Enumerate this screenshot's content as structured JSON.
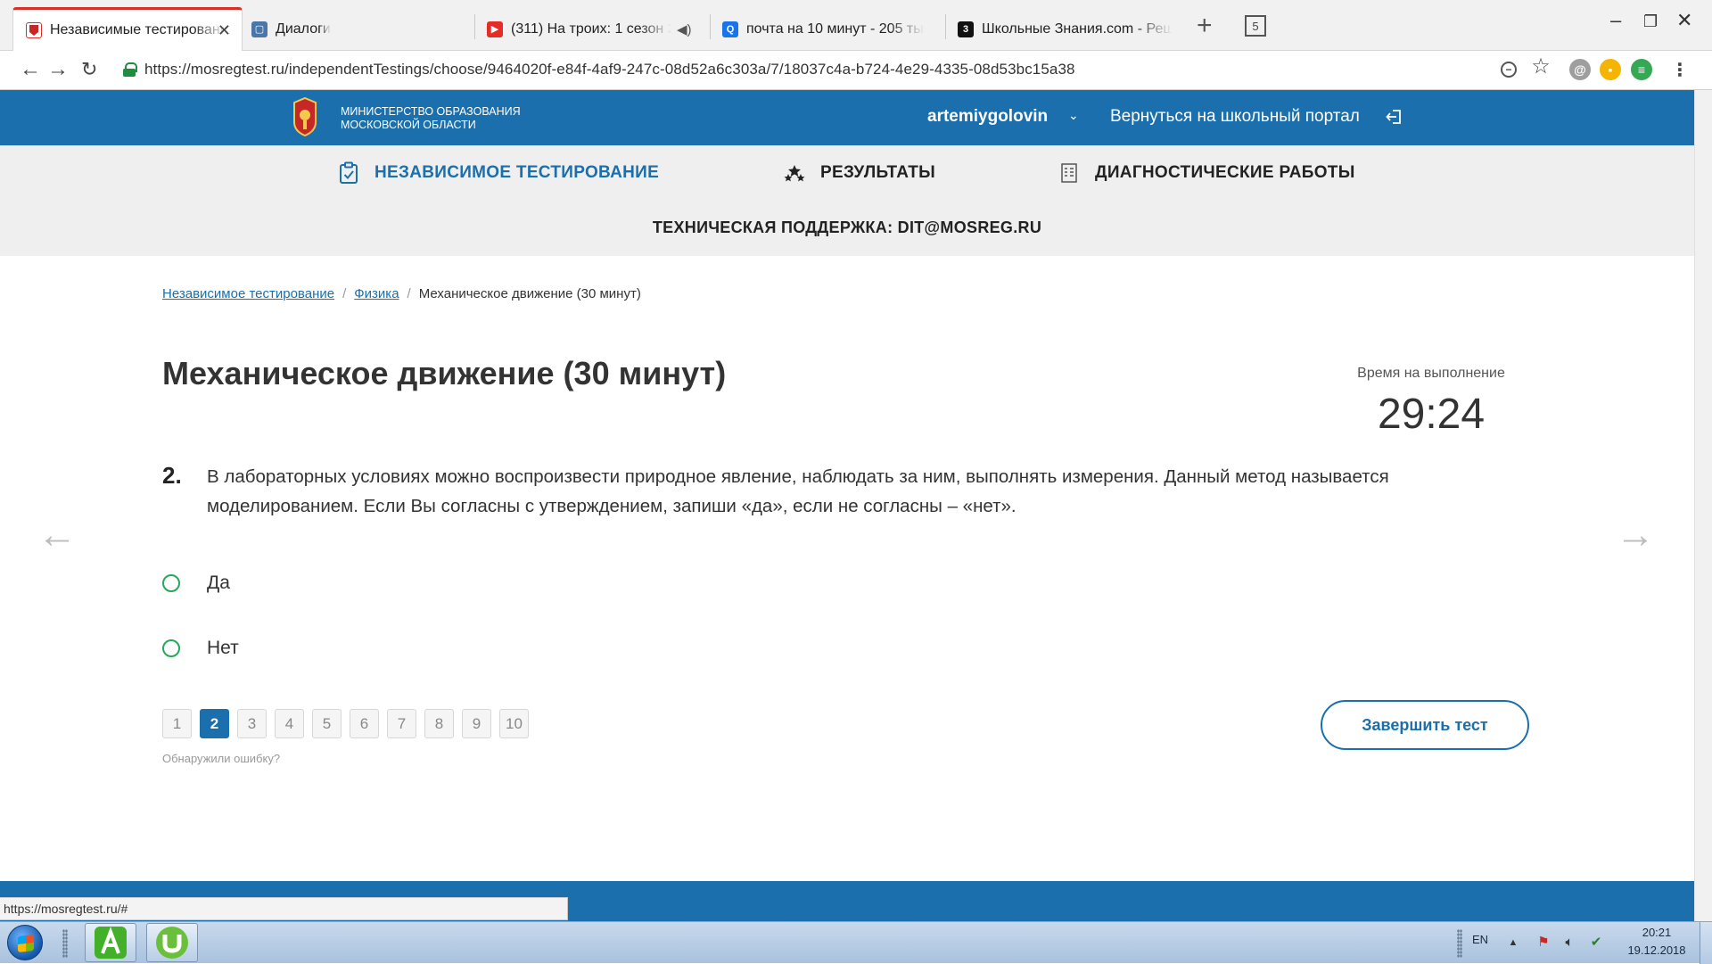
{
  "browser": {
    "tabs": [
      {
        "title": "Независимые тестирования",
        "active": true
      },
      {
        "title": "Диалоги",
        "active": false
      },
      {
        "title": "(311) На троих: 1 сезон 20 с",
        "active": false,
        "audio": true
      },
      {
        "title": "почта на 10 минут - 205 тыс. р",
        "active": false
      },
      {
        "title": "Школьные Знания.com - Реша",
        "active": false
      }
    ],
    "new_tab_glyph": "+",
    "tab_count": "5",
    "url": "https://mosregtest.ru/independentTestings/choose/9464020f-e84f-4af9-247c-08d52a6c303a/7/18037c4a-b724-4e29-4335-08d53bc15a38",
    "status_url": "https://mosregtest.ru/#"
  },
  "header": {
    "ministry_line1": "Министерство образования",
    "ministry_line2": "Московской области",
    "username": "artemiygolovin",
    "portal_link": "Вернуться на школьный портал"
  },
  "nav": {
    "items": [
      {
        "label": "НЕЗАВИСИМОЕ ТЕСТИРОВАНИЕ",
        "icon": "clipboard-icon",
        "active": true
      },
      {
        "label": "РЕЗУЛЬТАТЫ",
        "icon": "stars-icon",
        "active": false
      },
      {
        "label": "ДИАГНОСТИЧЕСКИЕ РАБОТЫ",
        "icon": "document-icon",
        "active": false
      }
    ],
    "support": "ТЕХНИЧЕСКАЯ ПОДДЕРЖКА: DIT@MOSREG.RU"
  },
  "breadcrumb": {
    "items": [
      "Независимое тестирование",
      "Физика",
      "Механическое движение (30 минут)"
    ],
    "separator": "/"
  },
  "test": {
    "title": "Механическое движение (30 минут)",
    "timer_label": "Время на выполнение",
    "timer": "29:24",
    "question_number": "2.",
    "question_text": "В лабораторных условиях можно воспроизвести природное явление, наблюдать за ним, выполнять измерения. Данный метод называется моделированием. Если Вы согласны с утверждением, запиши «да», если не согласны – «нет».",
    "options": [
      "Да",
      "Нет"
    ],
    "pages": [
      "1",
      "2",
      "3",
      "4",
      "5",
      "6",
      "7",
      "8",
      "9",
      "10"
    ],
    "current_page": "2",
    "report_link": "Обнаружили ошибку?",
    "finish_label": "Завершить тест",
    "prev_arrow": "←",
    "next_arrow": "→"
  },
  "taskbar": {
    "lang": "EN",
    "time": "20:21",
    "date": "19.12.2018"
  },
  "colors": {
    "brand_blue": "#1a6fac",
    "radio_green": "#27a85a",
    "nav_bg": "#efefef"
  }
}
